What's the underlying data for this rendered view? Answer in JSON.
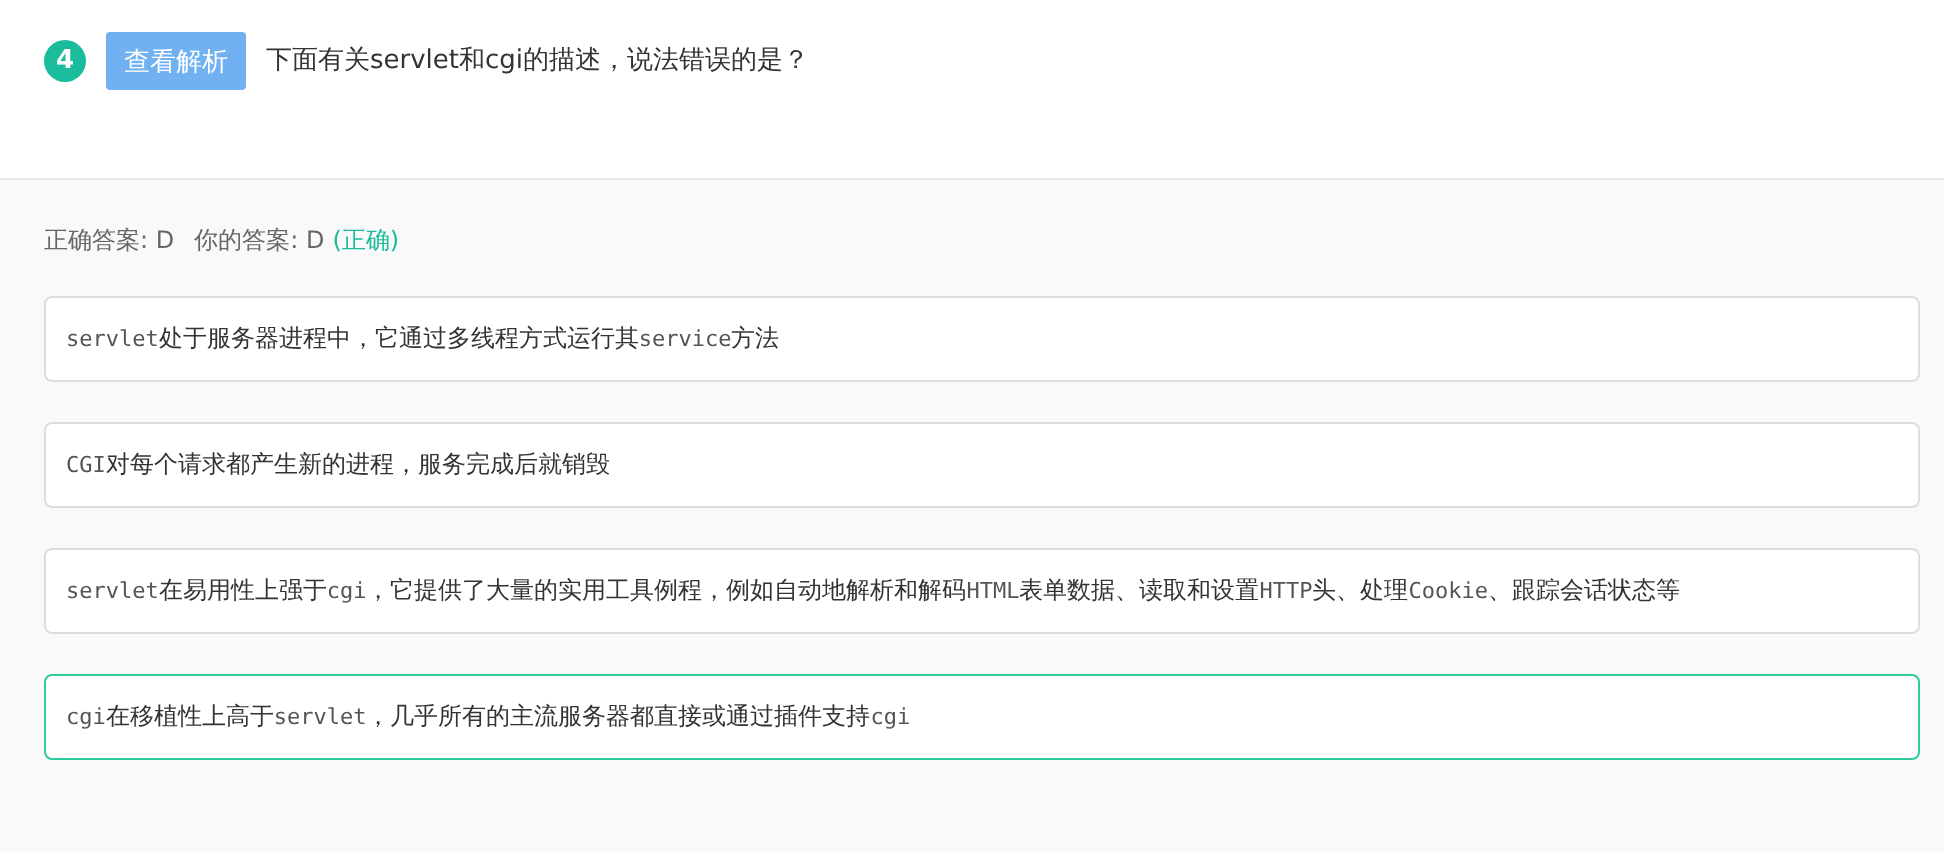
{
  "question": {
    "number": "4",
    "analysis_button": "查看解析",
    "text": "下面有关servlet和cgi的描述，说法错误的是？"
  },
  "result": {
    "correct_label": "正确答案: D",
    "your_label": "你的答案: D",
    "verdict": "(正确)"
  },
  "options": [
    {
      "selected": false,
      "parts": [
        {
          "kind": "code",
          "text": "servlet"
        },
        {
          "kind": "plain",
          "text": "处于服务器进程中，它通过多线程方式运行其"
        },
        {
          "kind": "code",
          "text": "service"
        },
        {
          "kind": "plain",
          "text": "方法"
        }
      ]
    },
    {
      "selected": false,
      "parts": [
        {
          "kind": "code",
          "text": "CGI"
        },
        {
          "kind": "plain",
          "text": "对每个请求都产生新的进程，服务完成后就销毁"
        }
      ]
    },
    {
      "selected": false,
      "parts": [
        {
          "kind": "code",
          "text": "servlet"
        },
        {
          "kind": "plain",
          "text": "在易用性上强于"
        },
        {
          "kind": "code",
          "text": "cgi"
        },
        {
          "kind": "plain",
          "text": "，它提供了大量的实用工具例程，例如自动地解析和解码"
        },
        {
          "kind": "code",
          "text": "HTML"
        },
        {
          "kind": "plain",
          "text": "表单数据、读取和设置"
        },
        {
          "kind": "code",
          "text": "HTTP"
        },
        {
          "kind": "plain",
          "text": "头、处理"
        },
        {
          "kind": "code",
          "text": "Cookie"
        },
        {
          "kind": "plain",
          "text": "、跟踪会话状态等"
        }
      ]
    },
    {
      "selected": true,
      "parts": [
        {
          "kind": "code",
          "text": "cgi"
        },
        {
          "kind": "plain",
          "text": "在移植性上高于"
        },
        {
          "kind": "code",
          "text": "servlet"
        },
        {
          "kind": "plain",
          "text": "，几乎所有的主流服务器都直接或通过插件支持"
        },
        {
          "kind": "code",
          "text": "cgi"
        }
      ]
    }
  ]
}
